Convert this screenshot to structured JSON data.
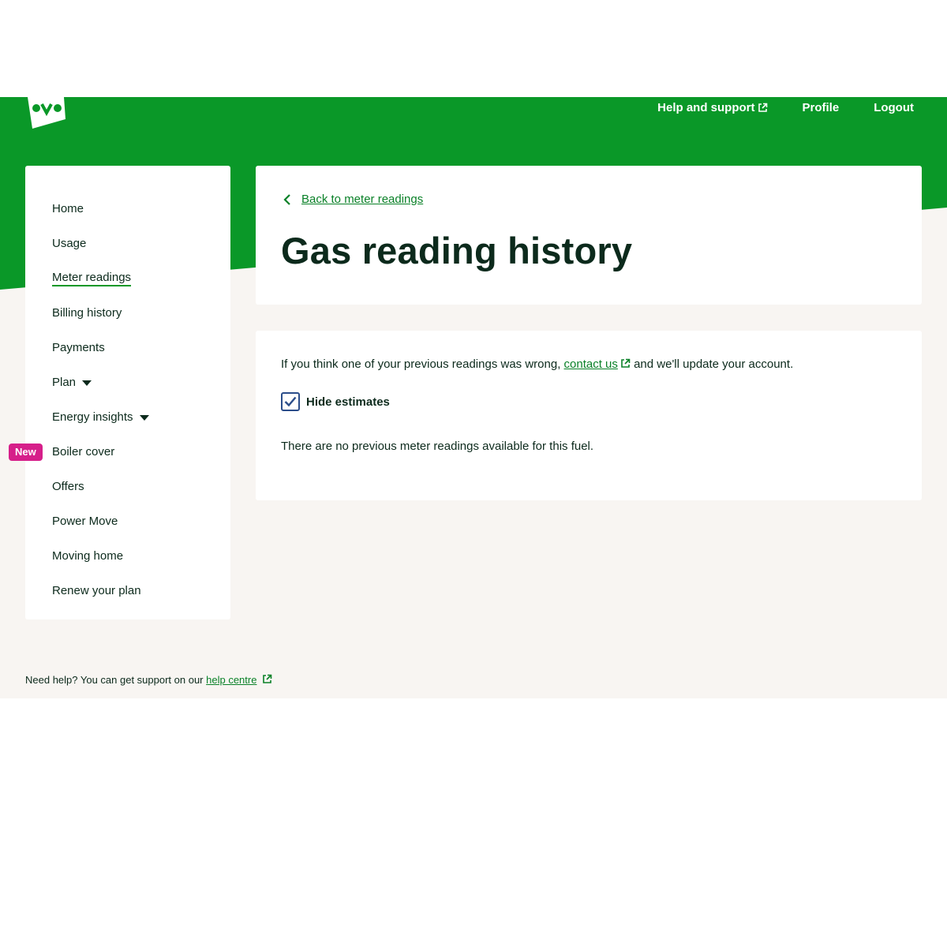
{
  "colors": {
    "brand_green": "#0a9828",
    "link_green": "#0a8128",
    "badge_pink": "#d61f8a",
    "page_background": "#f8f5f2",
    "text_dark": "#0c2a1c"
  },
  "header": {
    "logo_icon": "ovo-logo-icon",
    "nav": [
      {
        "label": "Help and support",
        "external": true
      },
      {
        "label": "Profile"
      },
      {
        "label": "Logout"
      }
    ]
  },
  "sidebar": {
    "items": [
      {
        "label": "Home"
      },
      {
        "label": "Usage"
      },
      {
        "label": "Meter readings",
        "active": true
      },
      {
        "label": "Billing history"
      },
      {
        "label": "Payments"
      },
      {
        "label": "Plan",
        "has_dropdown": true
      },
      {
        "label": "Energy insights",
        "has_dropdown": true
      },
      {
        "label": "Boiler cover",
        "badge": "New"
      },
      {
        "label": "Offers"
      },
      {
        "label": "Power Move"
      },
      {
        "label": "Moving home"
      },
      {
        "label": "Renew your plan"
      }
    ]
  },
  "main": {
    "back_link": "Back to meter readings",
    "title": "Gas reading history",
    "info_prefix": "If you think one of your previous readings was wrong, ",
    "info_link": "contact us",
    "info_suffix": " and we'll update your account.",
    "hide_estimates_label": "Hide estimates",
    "hide_estimates_checked": true,
    "empty_message": "There are no previous meter readings available for this fuel."
  },
  "footer": {
    "help_text": "Need help? You can get support on our ",
    "help_link": "help centre"
  }
}
